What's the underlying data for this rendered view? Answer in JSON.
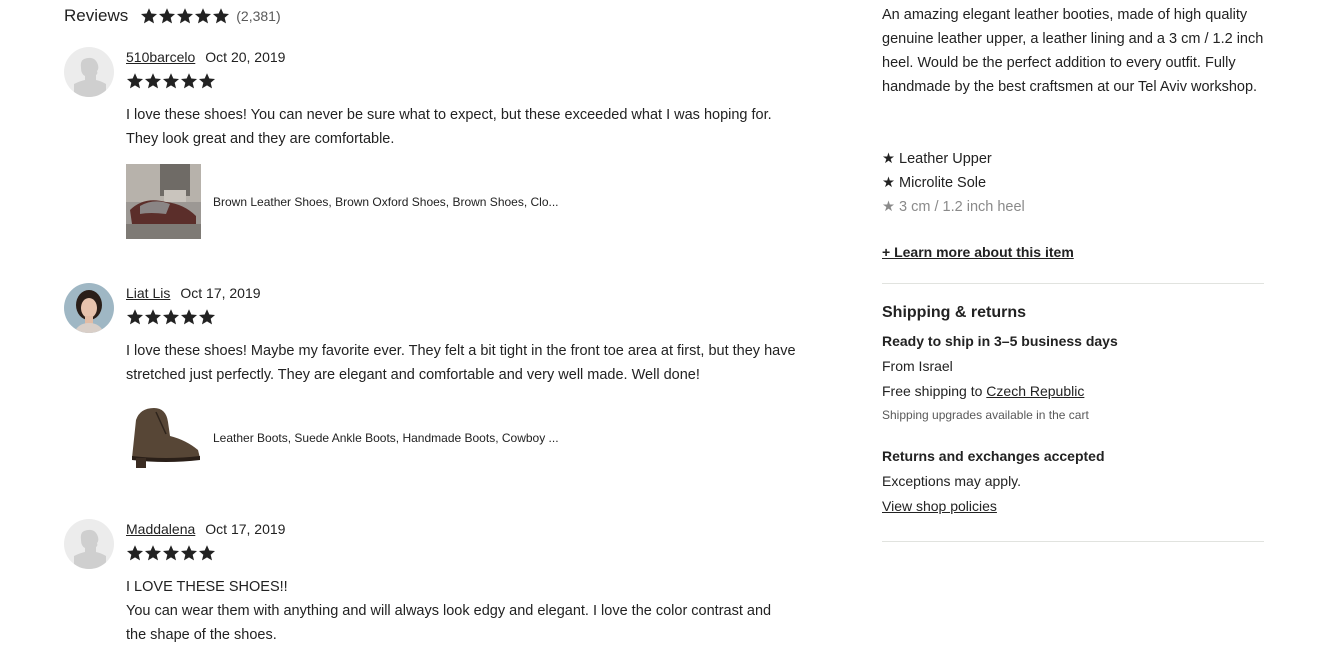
{
  "reviews_header": {
    "title": "Reviews",
    "count": "(2,381)",
    "rating": 5
  },
  "reviews": [
    {
      "author": "510barcelo",
      "date": "Oct 20, 2019",
      "rating": 5,
      "text": "I love these shoes! You can never be sure what to expect, but these exceeded what I was hoping for.\nThey look great and they are comfortable.",
      "listing_title": "Brown Leather Shoes, Brown Oxford Shoes, Brown Shoes, Clo...",
      "avatar_type": "default"
    },
    {
      "author": "Liat Lis",
      "date": "Oct 17, 2019",
      "rating": 5,
      "text": "I love these shoes! Maybe my favorite ever. They felt a bit tight in the front toe area at first, but they have\nstretched just perfectly. They are elegant and comfortable and very well made. Well done!",
      "listing_title": "Leather Boots, Suede Ankle Boots, Handmade Boots, Cowboy ...",
      "avatar_type": "photo"
    },
    {
      "author": "Maddalena",
      "date": "Oct 17, 2019",
      "rating": 5,
      "text": "I LOVE THESE SHOES!!\nYou can wear them with anything and will always look edgy and elegant. I love the color contrast and\nthe shape of the shoes.",
      "avatar_type": "default"
    }
  ],
  "description": {
    "text": "An amazing elegant leather booties, made of high quality genuine leather upper, a leather lining and a 3 cm / 1.2 inch heel. Would be the perfect addition to every outfit. Fully handmade by the best craftsmen at our Tel Aviv workshop.",
    "features": [
      "★ Leather Upper",
      "★ Microlite Sole",
      "★ 3 cm / 1.2 inch heel"
    ],
    "learn_more": "+ Learn more about this item"
  },
  "shipping": {
    "title": "Shipping & returns",
    "ready": "Ready to ship in 3–5 business days",
    "from": "From Israel",
    "free_prefix": "Free shipping to ",
    "destination": "Czech Republic",
    "upgrades": "Shipping upgrades available in the cart",
    "returns": "Returns and exchanges accepted",
    "exceptions": "Exceptions may apply.",
    "policies": "View shop policies"
  },
  "colors": {
    "text": "#222222",
    "muted": "#595959",
    "divider": "#e1e3df",
    "star": "#222222"
  },
  "icons": {
    "star": "star-icon",
    "avatar": "default-avatar-icon"
  }
}
